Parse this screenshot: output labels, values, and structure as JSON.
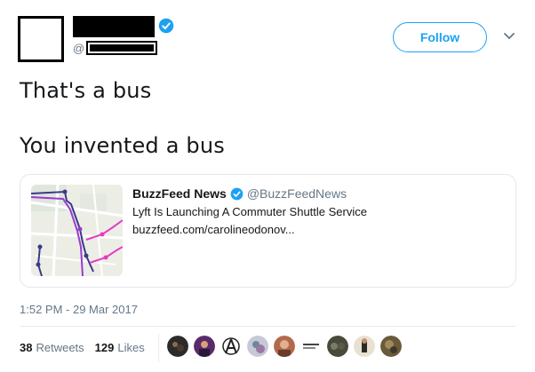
{
  "tweet": {
    "handle_prefix": "@",
    "follow_label": "Follow",
    "lines": [
      "That's a bus",
      "You invented a bus"
    ],
    "timestamp": "1:52 PM - 29 Mar 2017"
  },
  "card": {
    "name": "BuzzFeed News",
    "handle": "@BuzzFeedNews",
    "headline": "Lyft Is Launching A Commuter Shuttle Service",
    "domain": "buzzfeed.com/carolineodonov..."
  },
  "stats": {
    "retweets_count": "38",
    "retweets_label": "Retweets",
    "likes_count": "129",
    "likes_label": "Likes"
  },
  "colors": {
    "accent": "#1da1f2",
    "text": "#14171a",
    "muted": "#657786"
  },
  "icons": [
    "verified-icon",
    "chevron-down-icon"
  ]
}
